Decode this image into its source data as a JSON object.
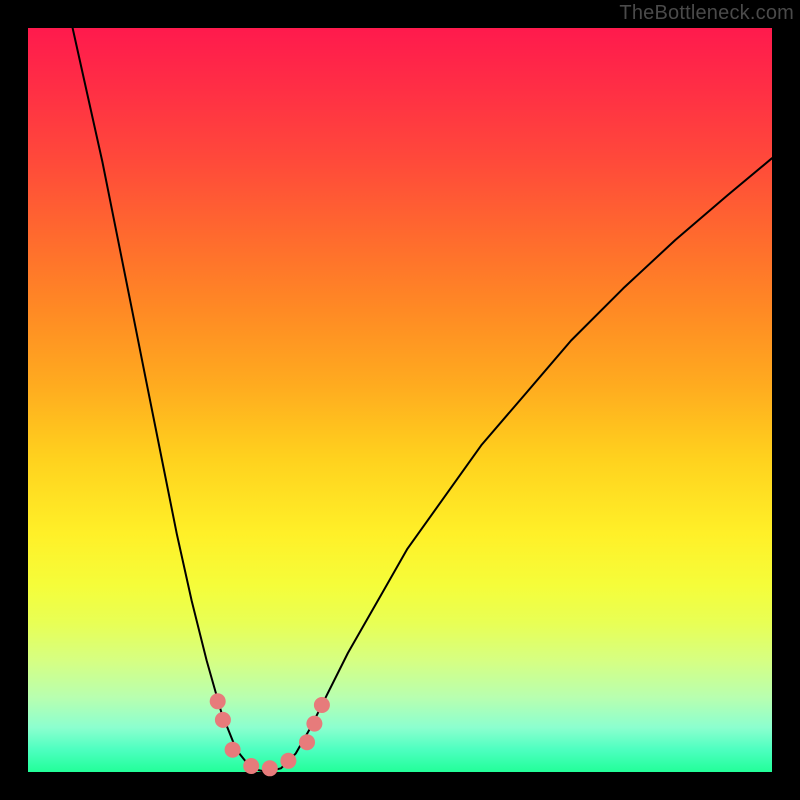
{
  "watermark": {
    "text": "TheBottleneck.com"
  },
  "chart_data": {
    "type": "line",
    "title": "",
    "xlabel": "",
    "ylabel": "",
    "xlim": [
      0,
      1
    ],
    "ylim": [
      0,
      1
    ],
    "series": [
      {
        "name": "curve",
        "comment": "Two-branch valley curve; x normalized 0–1 across plot width, y normalized 0–1 (0 = top, 1 = bottom). Minimum near x≈0.31, y≈1.0.",
        "points": [
          {
            "x": 0.06,
            "y": 0.0
          },
          {
            "x": 0.08,
            "y": 0.09
          },
          {
            "x": 0.1,
            "y": 0.18
          },
          {
            "x": 0.12,
            "y": 0.28
          },
          {
            "x": 0.14,
            "y": 0.38
          },
          {
            "x": 0.16,
            "y": 0.48
          },
          {
            "x": 0.18,
            "y": 0.58
          },
          {
            "x": 0.2,
            "y": 0.68
          },
          {
            "x": 0.22,
            "y": 0.77
          },
          {
            "x": 0.24,
            "y": 0.85
          },
          {
            "x": 0.26,
            "y": 0.92
          },
          {
            "x": 0.28,
            "y": 0.97
          },
          {
            "x": 0.3,
            "y": 0.995
          },
          {
            "x": 0.32,
            "y": 1.0
          },
          {
            "x": 0.34,
            "y": 0.995
          },
          {
            "x": 0.36,
            "y": 0.975
          },
          {
            "x": 0.38,
            "y": 0.94
          },
          {
            "x": 0.4,
            "y": 0.9
          },
          {
            "x": 0.43,
            "y": 0.84
          },
          {
            "x": 0.47,
            "y": 0.77
          },
          {
            "x": 0.51,
            "y": 0.7
          },
          {
            "x": 0.56,
            "y": 0.63
          },
          {
            "x": 0.61,
            "y": 0.56
          },
          {
            "x": 0.67,
            "y": 0.49
          },
          {
            "x": 0.73,
            "y": 0.42
          },
          {
            "x": 0.8,
            "y": 0.35
          },
          {
            "x": 0.87,
            "y": 0.285
          },
          {
            "x": 0.94,
            "y": 0.225
          },
          {
            "x": 1.0,
            "y": 0.175
          }
        ]
      },
      {
        "name": "markers",
        "comment": "Salmon dots near valley bottom",
        "color": "#e77b7b",
        "points": [
          {
            "x": 0.255,
            "y": 0.905
          },
          {
            "x": 0.262,
            "y": 0.93
          },
          {
            "x": 0.275,
            "y": 0.97
          },
          {
            "x": 0.3,
            "y": 0.992
          },
          {
            "x": 0.325,
            "y": 0.995
          },
          {
            "x": 0.35,
            "y": 0.985
          },
          {
            "x": 0.375,
            "y": 0.96
          },
          {
            "x": 0.385,
            "y": 0.935
          },
          {
            "x": 0.395,
            "y": 0.91
          }
        ]
      }
    ],
    "background_gradient": {
      "direction": "top-to-bottom",
      "stops": [
        {
          "pos": 0.0,
          "color": "#ff1a4d"
        },
        {
          "pos": 0.5,
          "color": "#ffc21e"
        },
        {
          "pos": 0.75,
          "color": "#f5fd3a"
        },
        {
          "pos": 1.0,
          "color": "#22ff99"
        }
      ]
    }
  }
}
